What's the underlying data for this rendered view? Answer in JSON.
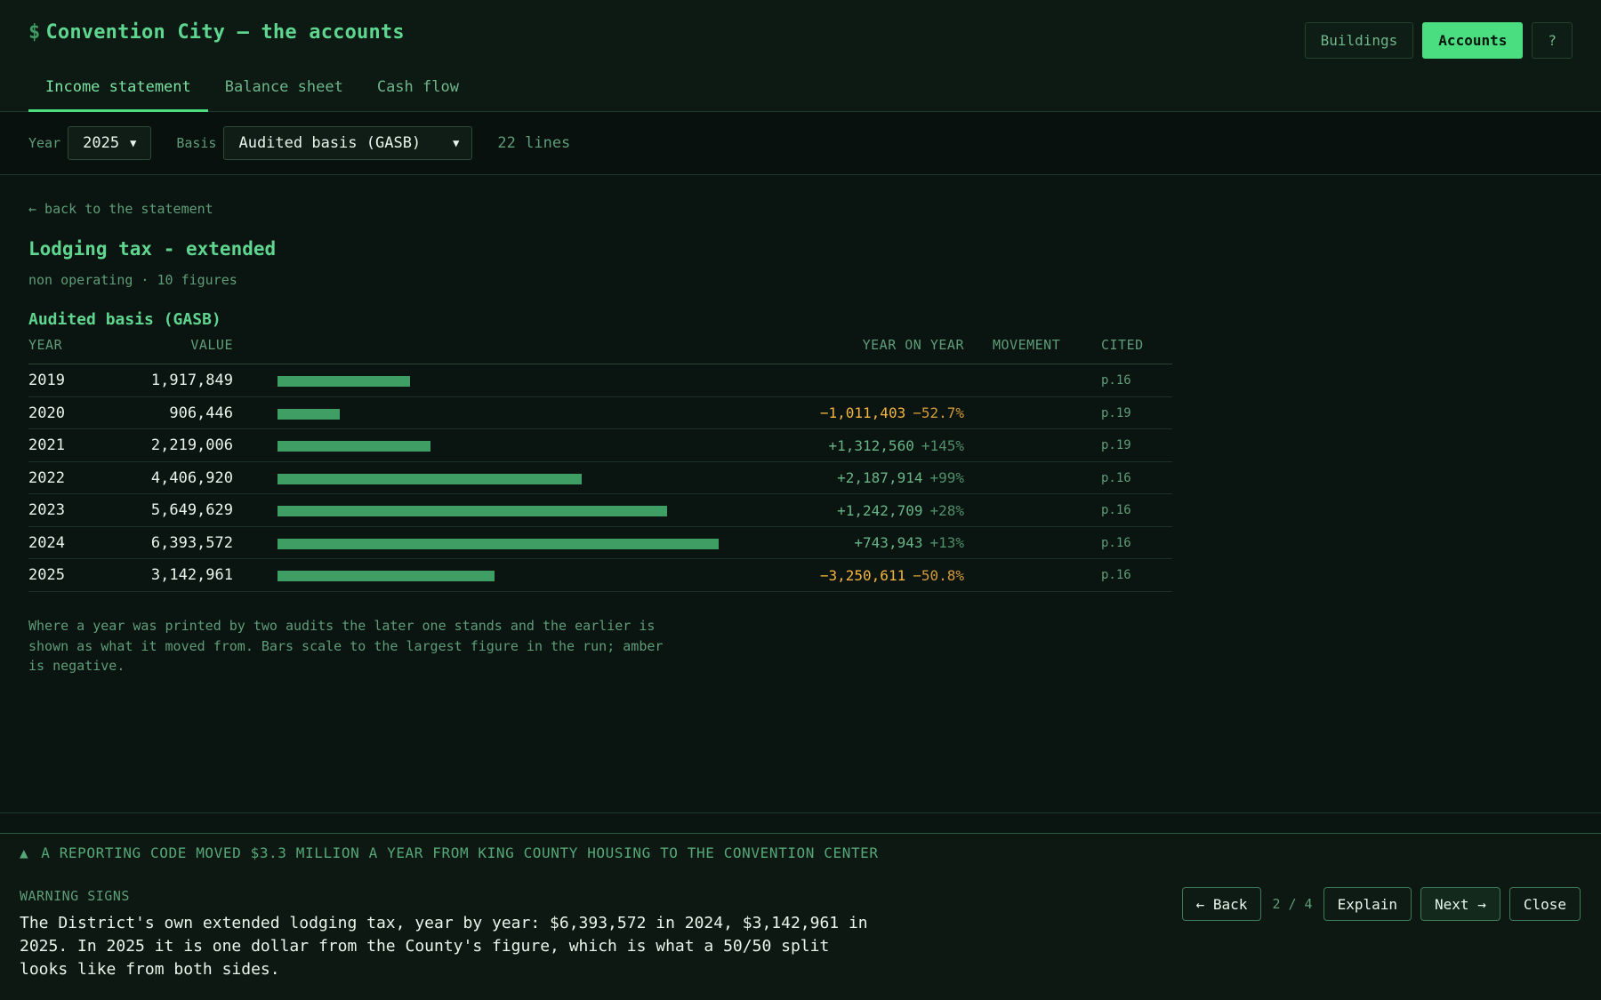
{
  "app": {
    "title": "Convention City — the accounts",
    "title_icon": "$"
  },
  "top_buttons": {
    "buildings": "Buildings",
    "accounts": "Accounts",
    "help": "?"
  },
  "tabs": [
    {
      "label": "Income statement",
      "active": true
    },
    {
      "label": "Balance sheet",
      "active": false
    },
    {
      "label": "Cash flow",
      "active": false
    }
  ],
  "filters": {
    "year_label": "Year",
    "year_value": "2025",
    "basis_label": "Basis",
    "basis_value": "Audited basis (GASB)",
    "lines_count": "22 lines"
  },
  "detail": {
    "back_link": "← back to the statement",
    "title": "Lodging tax - extended",
    "subtitle": "non operating · 10 figures",
    "basis_heading": "Audited basis (GASB)",
    "columns": {
      "year": "YEAR",
      "value": "VALUE",
      "yoy": "YEAR ON YEAR",
      "movement": "MOVEMENT",
      "cited": "CITED"
    },
    "rows": [
      {
        "year": "2019",
        "value": "1,917,849",
        "delta": "",
        "pct": "",
        "sign": "none",
        "cited": "p.16",
        "amount": 1917849
      },
      {
        "year": "2020",
        "value": "906,446",
        "delta": "−1,011,403",
        "pct": "−52.7%",
        "sign": "neg",
        "cited": "p.19",
        "amount": 906446
      },
      {
        "year": "2021",
        "value": "2,219,006",
        "delta": "+1,312,560",
        "pct": "+145%",
        "sign": "pos",
        "cited": "p.19",
        "amount": 2219006
      },
      {
        "year": "2022",
        "value": "4,406,920",
        "delta": "+2,187,914",
        "pct": "+99%",
        "sign": "pos",
        "cited": "p.16",
        "amount": 4406920
      },
      {
        "year": "2023",
        "value": "5,649,629",
        "delta": "+1,242,709",
        "pct": "+28%",
        "sign": "pos",
        "cited": "p.16",
        "amount": 5649629
      },
      {
        "year": "2024",
        "value": "6,393,572",
        "delta": "+743,943",
        "pct": "+13%",
        "sign": "pos",
        "cited": "p.16",
        "amount": 6393572
      },
      {
        "year": "2025",
        "value": "3,142,961",
        "delta": "−3,250,611",
        "pct": "−50.8%",
        "sign": "neg",
        "cited": "p.16",
        "amount": 3142961
      }
    ],
    "footnote": "Where a year was printed by two audits the later one stands and the earlier is shown as what it moved from. Bars scale to the largest figure in the run; amber is negative."
  },
  "tour": {
    "headline": "A REPORTING CODE MOVED $3.3 MILLION A YEAR FROM KING COUNTY HOUSING TO THE CONVENTION CENTER",
    "kicker": "WARNING SIGNS",
    "body": "The District's own extended lodging tax, year by year: $6,393,572 in 2024, $3,142,961 in 2025. In 2025 it is one dollar from the County's figure, which is what a 50/50 split looks like from both sides.",
    "back": "← Back",
    "page": "2 / 4",
    "explain": "Explain",
    "next": "Next →",
    "close": "Close"
  },
  "colors": {
    "accent": "#4ade80",
    "bar": "#3f9e63",
    "negative": "#f4b43e",
    "background": "#0a1410"
  }
}
